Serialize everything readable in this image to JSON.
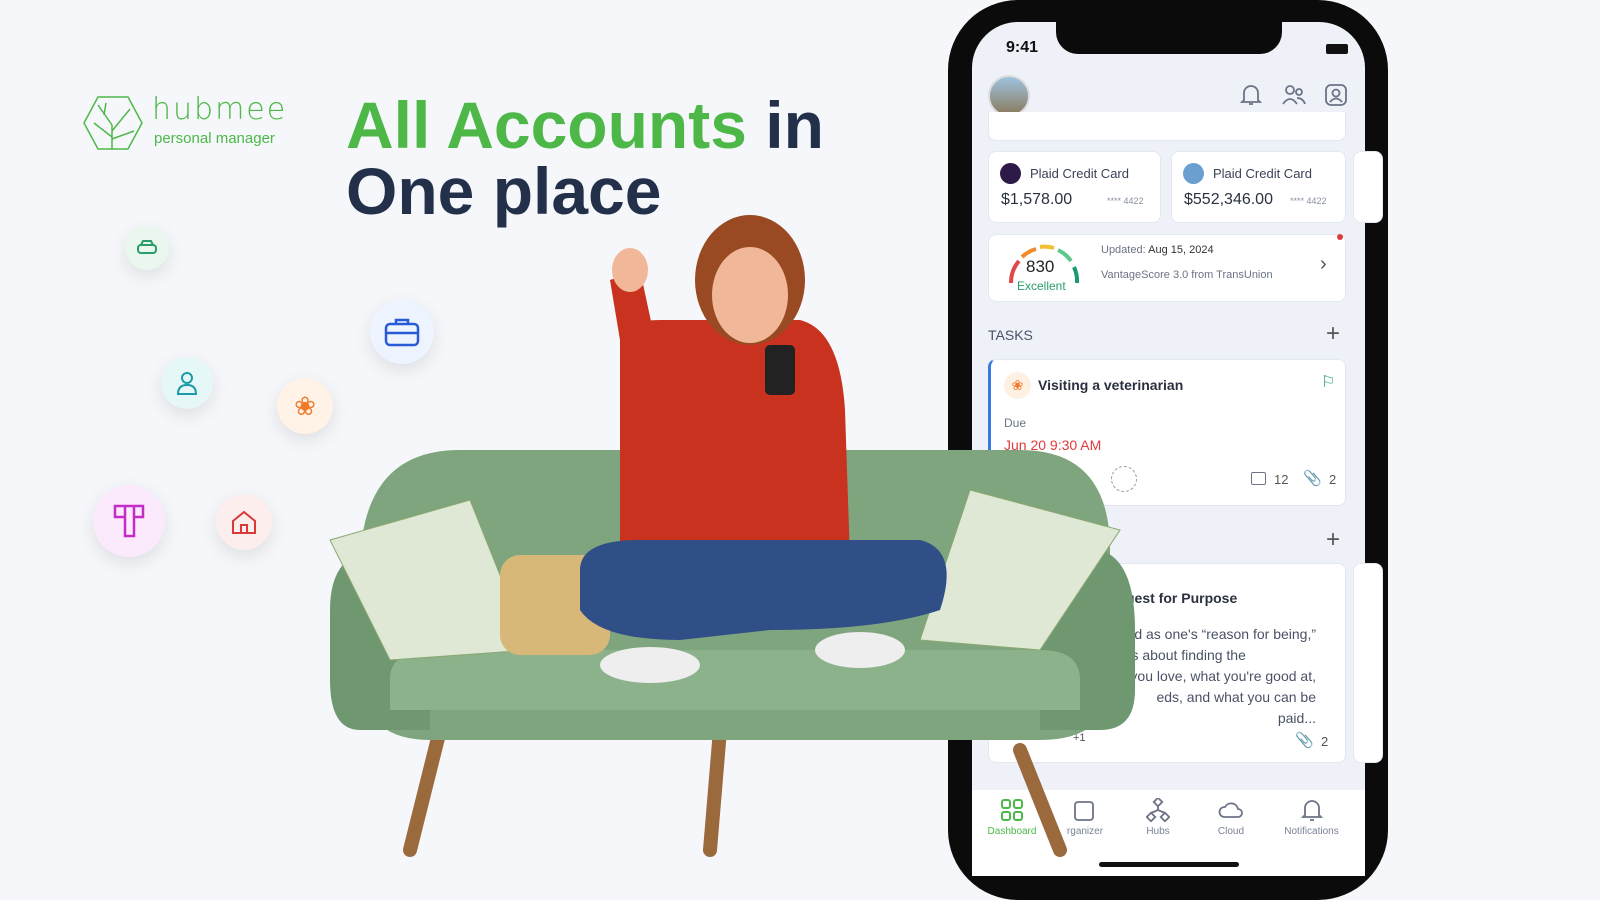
{
  "brand": {
    "name": "hubmee",
    "tagline": "personal manager"
  },
  "headline": {
    "highlight": "All Accounts",
    "rest_line1": "in",
    "line2": "One place"
  },
  "colors": {
    "brand_green": "#4db848",
    "navy": "#23304a",
    "due_red": "#e03b3b"
  },
  "floating_icons": [
    "car-icon",
    "briefcase-icon",
    "user-icon",
    "paw-icon",
    "hubmee-tile-icon",
    "home-icon"
  ],
  "phone": {
    "status": {
      "time": "9:41"
    },
    "header_icons": [
      "bell-icon",
      "people-icon",
      "contact-icon"
    ],
    "accounts": [
      {
        "name": "Plaid Credit Card",
        "balance": "$1,578.00",
        "mask": "**** 4422"
      },
      {
        "name": "Plaid Credit Card",
        "balance": "$552,346.00",
        "mask": "**** 4422"
      }
    ],
    "credit": {
      "score": "830",
      "rating": "Excellent",
      "updated_label": "Updated:",
      "updated_date": "Aug 15, 2024",
      "source": "VantageScore 3.0 from TransUnion"
    },
    "tasks": {
      "title": "TASKS",
      "item": {
        "title": "Visiting a veterinarian",
        "due_label": "Due",
        "due": "Jun 20 9:30 AM",
        "comments": "12",
        "attachments": "2"
      }
    },
    "note": {
      "title": "uest for Purpose",
      "lines": [
        "ed as one's “reason for being,”",
        "It's about finding the",
        "t you love, what you're good at,",
        "eds, and what you can be paid..."
      ],
      "attachments": "2",
      "extra": "+1"
    },
    "nav": [
      {
        "label": "Dashboard",
        "active": true
      },
      {
        "label": "rganizer"
      },
      {
        "label": "Hubs"
      },
      {
        "label": "Cloud"
      },
      {
        "label": "Notifications"
      }
    ]
  }
}
